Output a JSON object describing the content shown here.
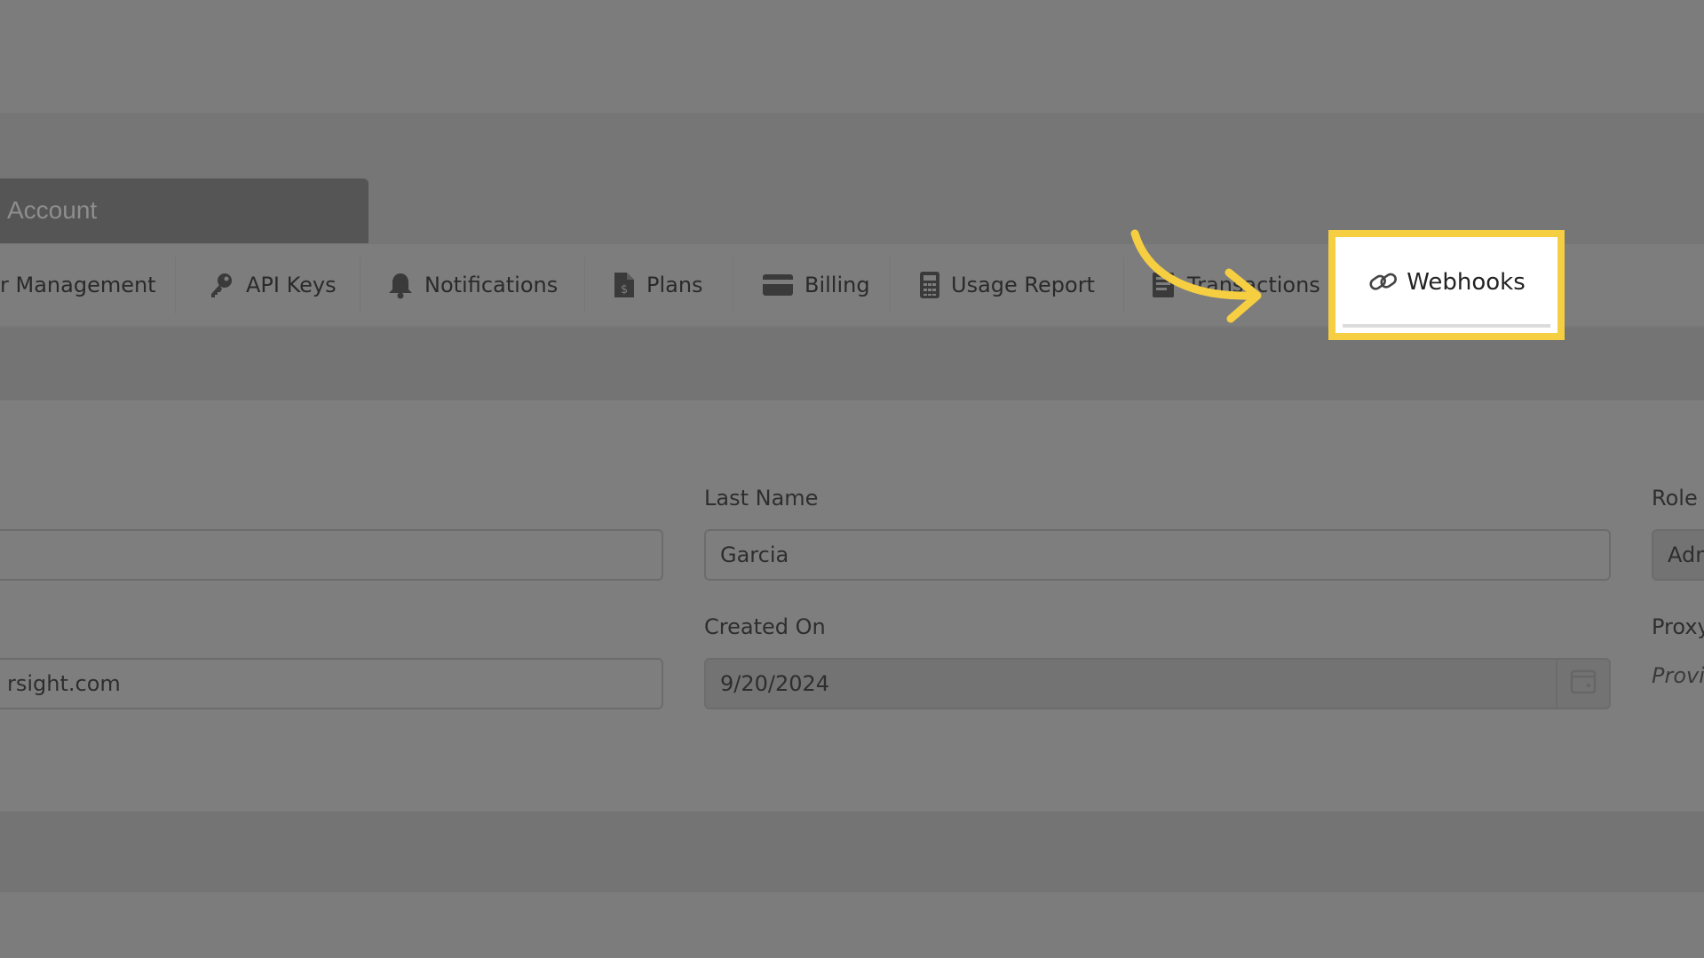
{
  "header": {
    "account_tab_label": "Account"
  },
  "tabs": [
    {
      "label": "r Management",
      "icon": "users-icon"
    },
    {
      "label": "API Keys",
      "icon": "key-icon"
    },
    {
      "label": "Notifications",
      "icon": "bell-icon"
    },
    {
      "label": "Plans",
      "icon": "file-dollar-icon"
    },
    {
      "label": "Billing",
      "icon": "credit-card-icon"
    },
    {
      "label": "Usage Report",
      "icon": "calculator-icon"
    },
    {
      "label": "Transactions",
      "icon": "transactions-icon"
    },
    {
      "label": "Webhooks",
      "icon": "link-icon",
      "active": true
    }
  ],
  "form": {
    "first_name_value": "",
    "last_name_label": "Last Name",
    "last_name_value": "Garcia",
    "role_label": "Role",
    "role_value": "Adm",
    "email_value": "rsight.com",
    "created_on_label": "Created On",
    "created_on_value": "9/20/2024",
    "proxy_label": "Proxy",
    "proxy_note": "Provi"
  },
  "annotation": {
    "highlight_color": "#f5ce42",
    "arrow_color": "#f5ce42"
  }
}
